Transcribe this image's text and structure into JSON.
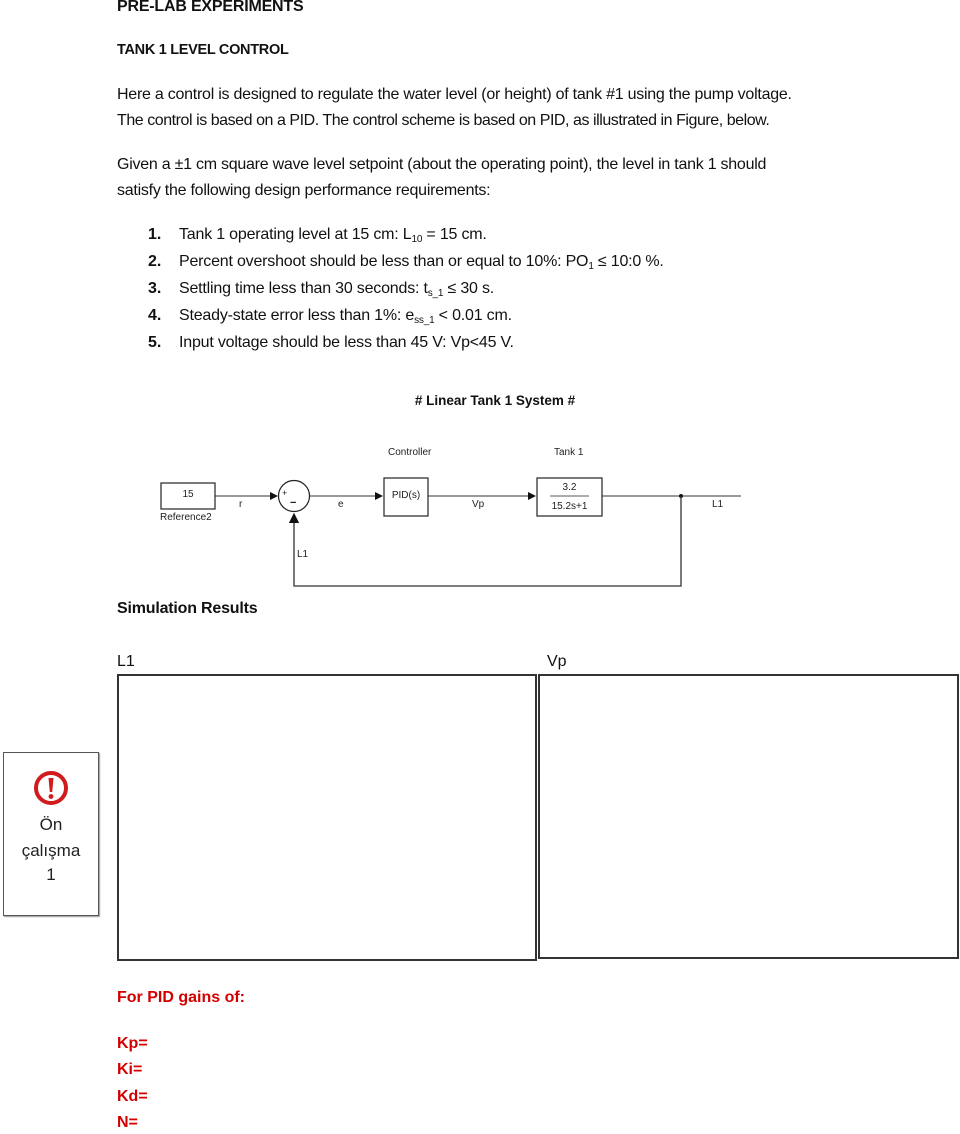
{
  "document": {
    "title": "PRE-LAB EXPERIMENTS",
    "subtitle": "TANK 1 LEVEL CONTROL",
    "paragraph1": {
      "line1": "Here a control is designed to regulate the water level (or height) of tank #1 using the pump voltage.",
      "line2": "The control is based on a PID. The control scheme is based on PID, as illustrated in Figure, below."
    },
    "paragraph2": {
      "line1": "Given a ±1 cm square wave level setpoint (about the operating point), the level in tank 1 should",
      "line2": "satisfy the following design performance requirements:"
    },
    "requirements": [
      {
        "num": "1.",
        "text": "Tank 1 operating level at 15 cm: L",
        "sub": "10",
        "tail": " = 15 cm."
      },
      {
        "num": "2.",
        "text": "Percent overshoot should be less than or equal to 10%: PO",
        "sub": "1",
        "tail": " ≤ 10:0 %."
      },
      {
        "num": "3.",
        "text": "Settling time less than 30 seconds: t",
        "sub": "s_1",
        "tail": " ≤  30 s."
      },
      {
        "num": "4.",
        "text": "Steady-state error less than 1%: e",
        "sub": "ss_1",
        "tail": " < 0.01 cm."
      },
      {
        "num": "5.",
        "text": "Input voltage should be less than 45 V: Vp<45 V.",
        "sub": "",
        "tail": ""
      }
    ]
  },
  "diagram": {
    "title": "# Linear Tank 1 System #",
    "controller_label": "Controller",
    "tank_label": "Tank 1",
    "reference_value": "15",
    "reference_name": "Reference2",
    "sum_plus": "+",
    "sum_minus": "−",
    "pid_block": "PID(s)",
    "tf_numerator": "3.2",
    "tf_denominator": "15.2s+1",
    "signals": {
      "r": "r",
      "e": "e",
      "vp": "Vp",
      "l1_out": "L1",
      "l1_feedback": "L1"
    }
  },
  "results": {
    "heading": "Simulation Results",
    "plot_left_label": "L1",
    "plot_right_label": "Vp"
  },
  "badge": {
    "line1": "Ön",
    "line2": "çalışma",
    "line3": "1",
    "icon": "exclamation-circle-icon",
    "icon_color": "#d01c1c"
  },
  "gains": {
    "heading": "For PID gains of:",
    "kp": "Kp=",
    "ki": "Ki=",
    "kd": "Kd=",
    "n": "N=",
    "color": "#d40000"
  }
}
